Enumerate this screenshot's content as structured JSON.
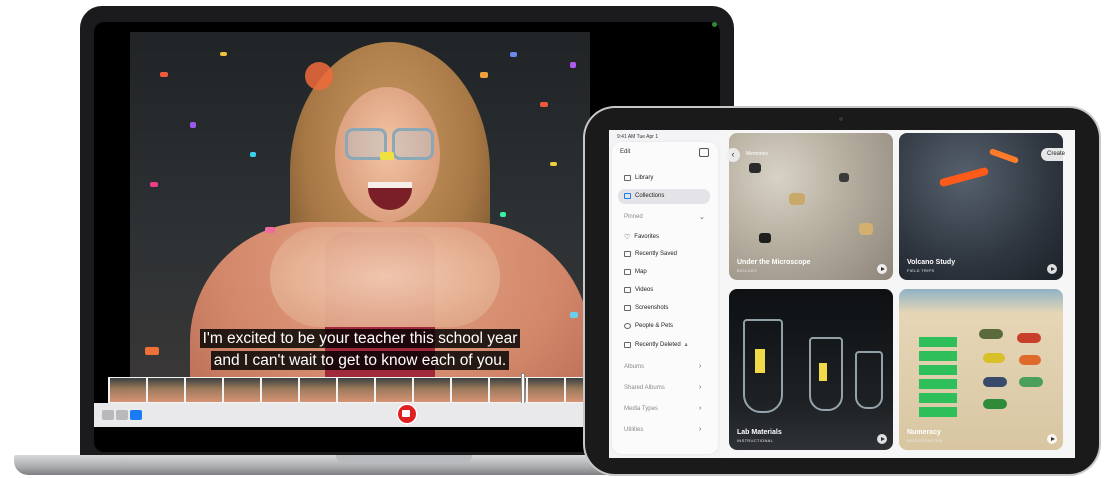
{
  "video": {
    "caption_line1": "I'm excited to be your teacher this school year",
    "caption_line2": "and I can't wait to get to know each of you."
  },
  "laptop_controls": {
    "record_icon": "video-camera-icon",
    "record_color": "#e02020",
    "accent": "#1a7cf5"
  },
  "ipad": {
    "status": {
      "time": "9:41 AM  Tue Apr 1",
      "battery": "100%"
    },
    "sidebar": {
      "edit_label": "Edit",
      "items": [
        {
          "label": "Library",
          "icon": "photo-library-icon"
        },
        {
          "label": "Collections",
          "icon": "collections-icon",
          "selected": true
        }
      ],
      "pinned_label": "Pinned",
      "pinned": [
        {
          "label": "Favorites",
          "icon": "heart-icon"
        },
        {
          "label": "Recently Saved",
          "icon": "recently-saved-icon"
        },
        {
          "label": "Map",
          "icon": "map-icon"
        },
        {
          "label": "Videos",
          "icon": "video-icon"
        },
        {
          "label": "Screenshots",
          "icon": "screenshot-icon"
        },
        {
          "label": "People & Pets",
          "icon": "person-icon"
        },
        {
          "label": "Recently Deleted",
          "icon": "trash-icon"
        }
      ],
      "sections": [
        "Albums",
        "Shared Albums",
        "Media Types",
        "Utilities"
      ]
    },
    "content": {
      "nav_title": "Memories",
      "create_label": "Create",
      "tiles": [
        {
          "title": "Under the Microscope",
          "subtitle": "BIOLOGY"
        },
        {
          "title": "Volcano Study",
          "subtitle": "FIELD TRIPS"
        },
        {
          "title": "Lab Materials",
          "subtitle": "INSTRUCTIONAL"
        },
        {
          "title": "Numeracy",
          "subtitle": "KINDERGARTEN"
        }
      ]
    }
  }
}
